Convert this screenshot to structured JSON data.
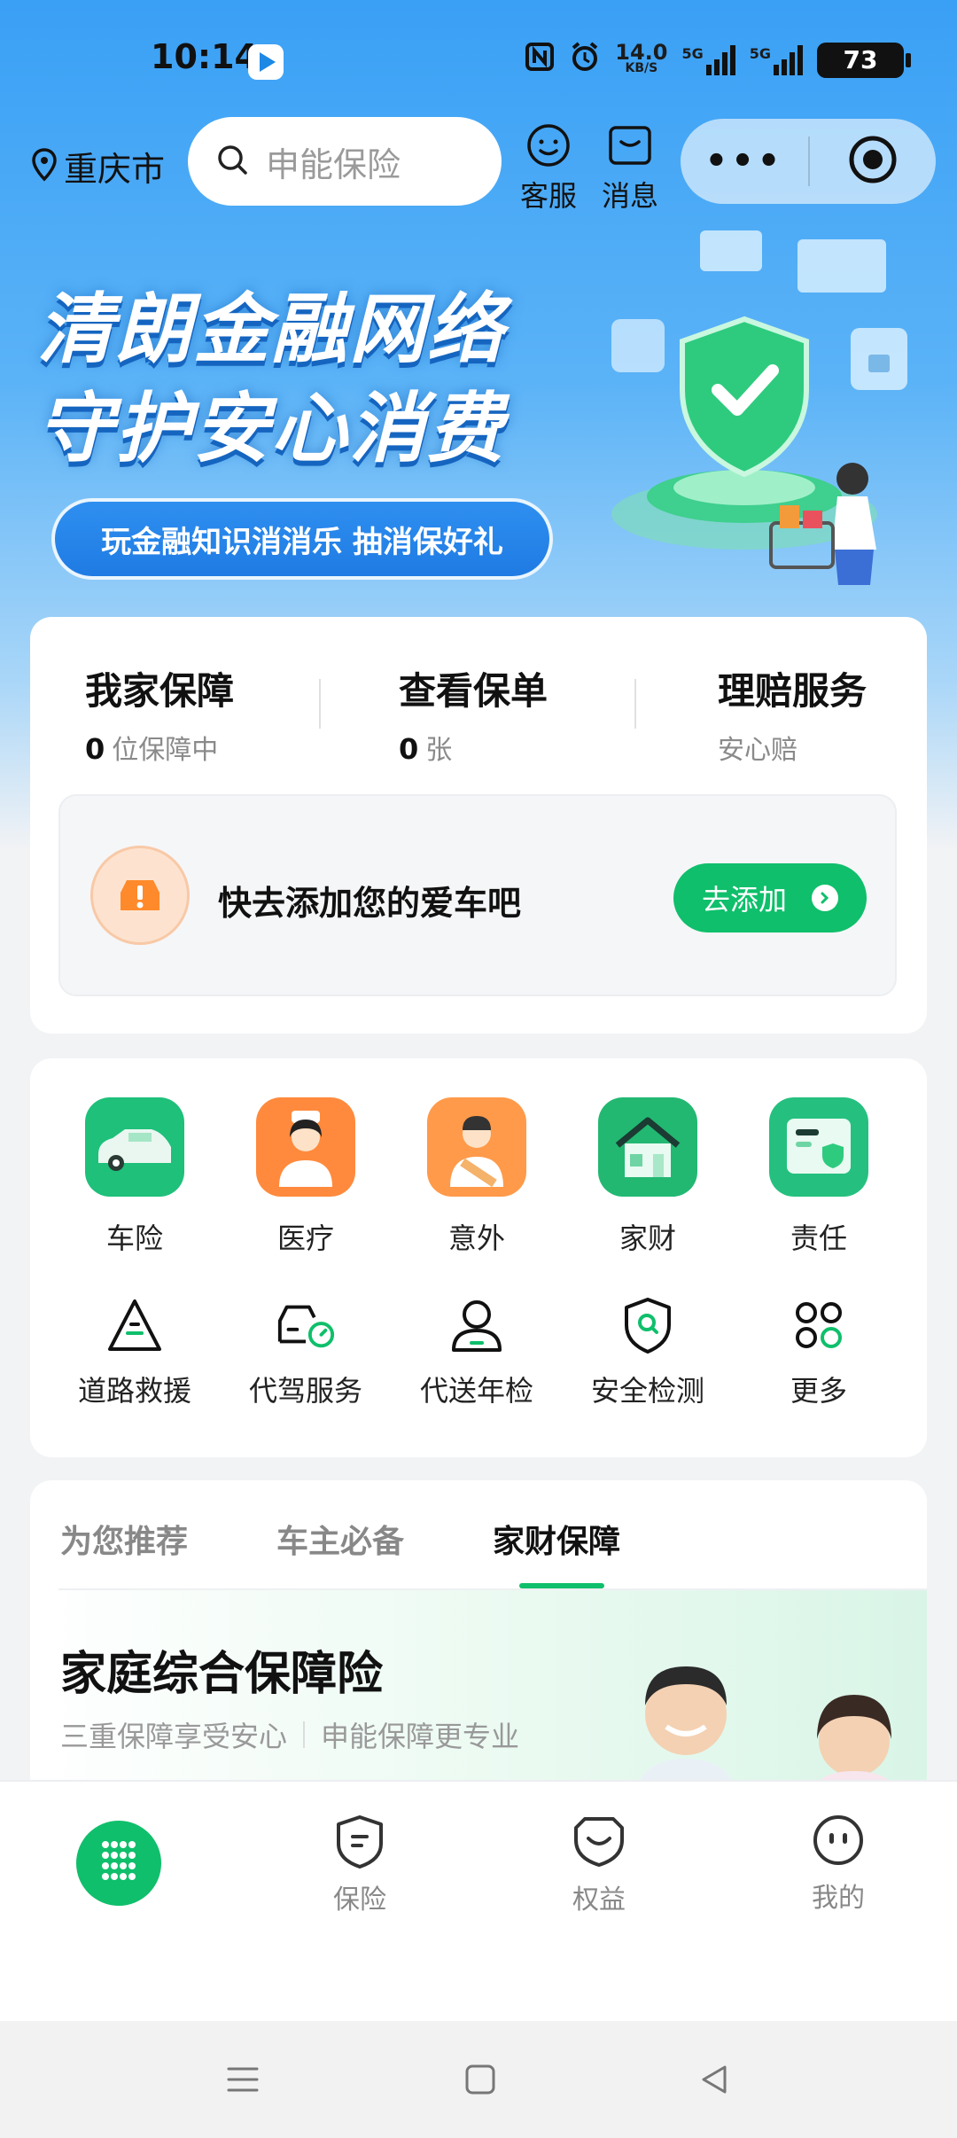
{
  "status": {
    "time": "10:14",
    "net_speed": "14.0",
    "net_unit": "KB/S",
    "sig1": "5G",
    "sig2": "5G",
    "battery": "73"
  },
  "header": {
    "location": "重庆市",
    "search_placeholder": "申能保险",
    "service_label": "客服",
    "message_label": "消息",
    "more_dots": "•••"
  },
  "banner": {
    "title_line1": "清朗金融网络",
    "title_line2": "守护安心消费",
    "pill": "玩金融知识消消乐 抽消保好礼"
  },
  "summary": {
    "items": [
      {
        "title": "我家保障",
        "value": "0",
        "sub": "位保障中"
      },
      {
        "title": "查看保单",
        "value": "0",
        "sub": "张"
      },
      {
        "title": "理赔服务",
        "value": "",
        "sub": "安心赔"
      }
    ],
    "car_prompt": "快去添加您的爱车吧",
    "add_button": "去添加"
  },
  "categories": [
    {
      "label": "车险",
      "icon": "car-icon",
      "color": "#1ec07a"
    },
    {
      "label": "医疗",
      "icon": "nurse-icon",
      "color": "#ff8a3d"
    },
    {
      "label": "意外",
      "icon": "bandage-person-icon",
      "color": "#ff9a4a"
    },
    {
      "label": "家财",
      "icon": "house-icon",
      "color": "#22b872"
    },
    {
      "label": "责任",
      "icon": "document-shield-icon",
      "color": "#25c07f"
    }
  ],
  "services": [
    {
      "label": "道路救援",
      "icon": "warning-triangle-icon"
    },
    {
      "label": "代驾服务",
      "icon": "driver-car-icon"
    },
    {
      "label": "代送年检",
      "icon": "person-icon"
    },
    {
      "label": "安全检测",
      "icon": "shield-search-icon"
    },
    {
      "label": "更多",
      "icon": "grid-dots-icon"
    }
  ],
  "tabs": [
    "为您推荐",
    "车主必备",
    "家财保障"
  ],
  "active_tab": "家财保障",
  "promo": {
    "title": "家庭综合保障险",
    "sub1": "三重保障享受安心",
    "sub2": "申能保障更专业"
  },
  "bottom_nav": [
    {
      "label": "",
      "icon": "home-grid-icon"
    },
    {
      "label": "保险",
      "icon": "shield-icon"
    },
    {
      "label": "权益",
      "icon": "gift-smile-icon"
    },
    {
      "label": "我的",
      "icon": "face-icon"
    }
  ],
  "accent": "#0fbf6b"
}
